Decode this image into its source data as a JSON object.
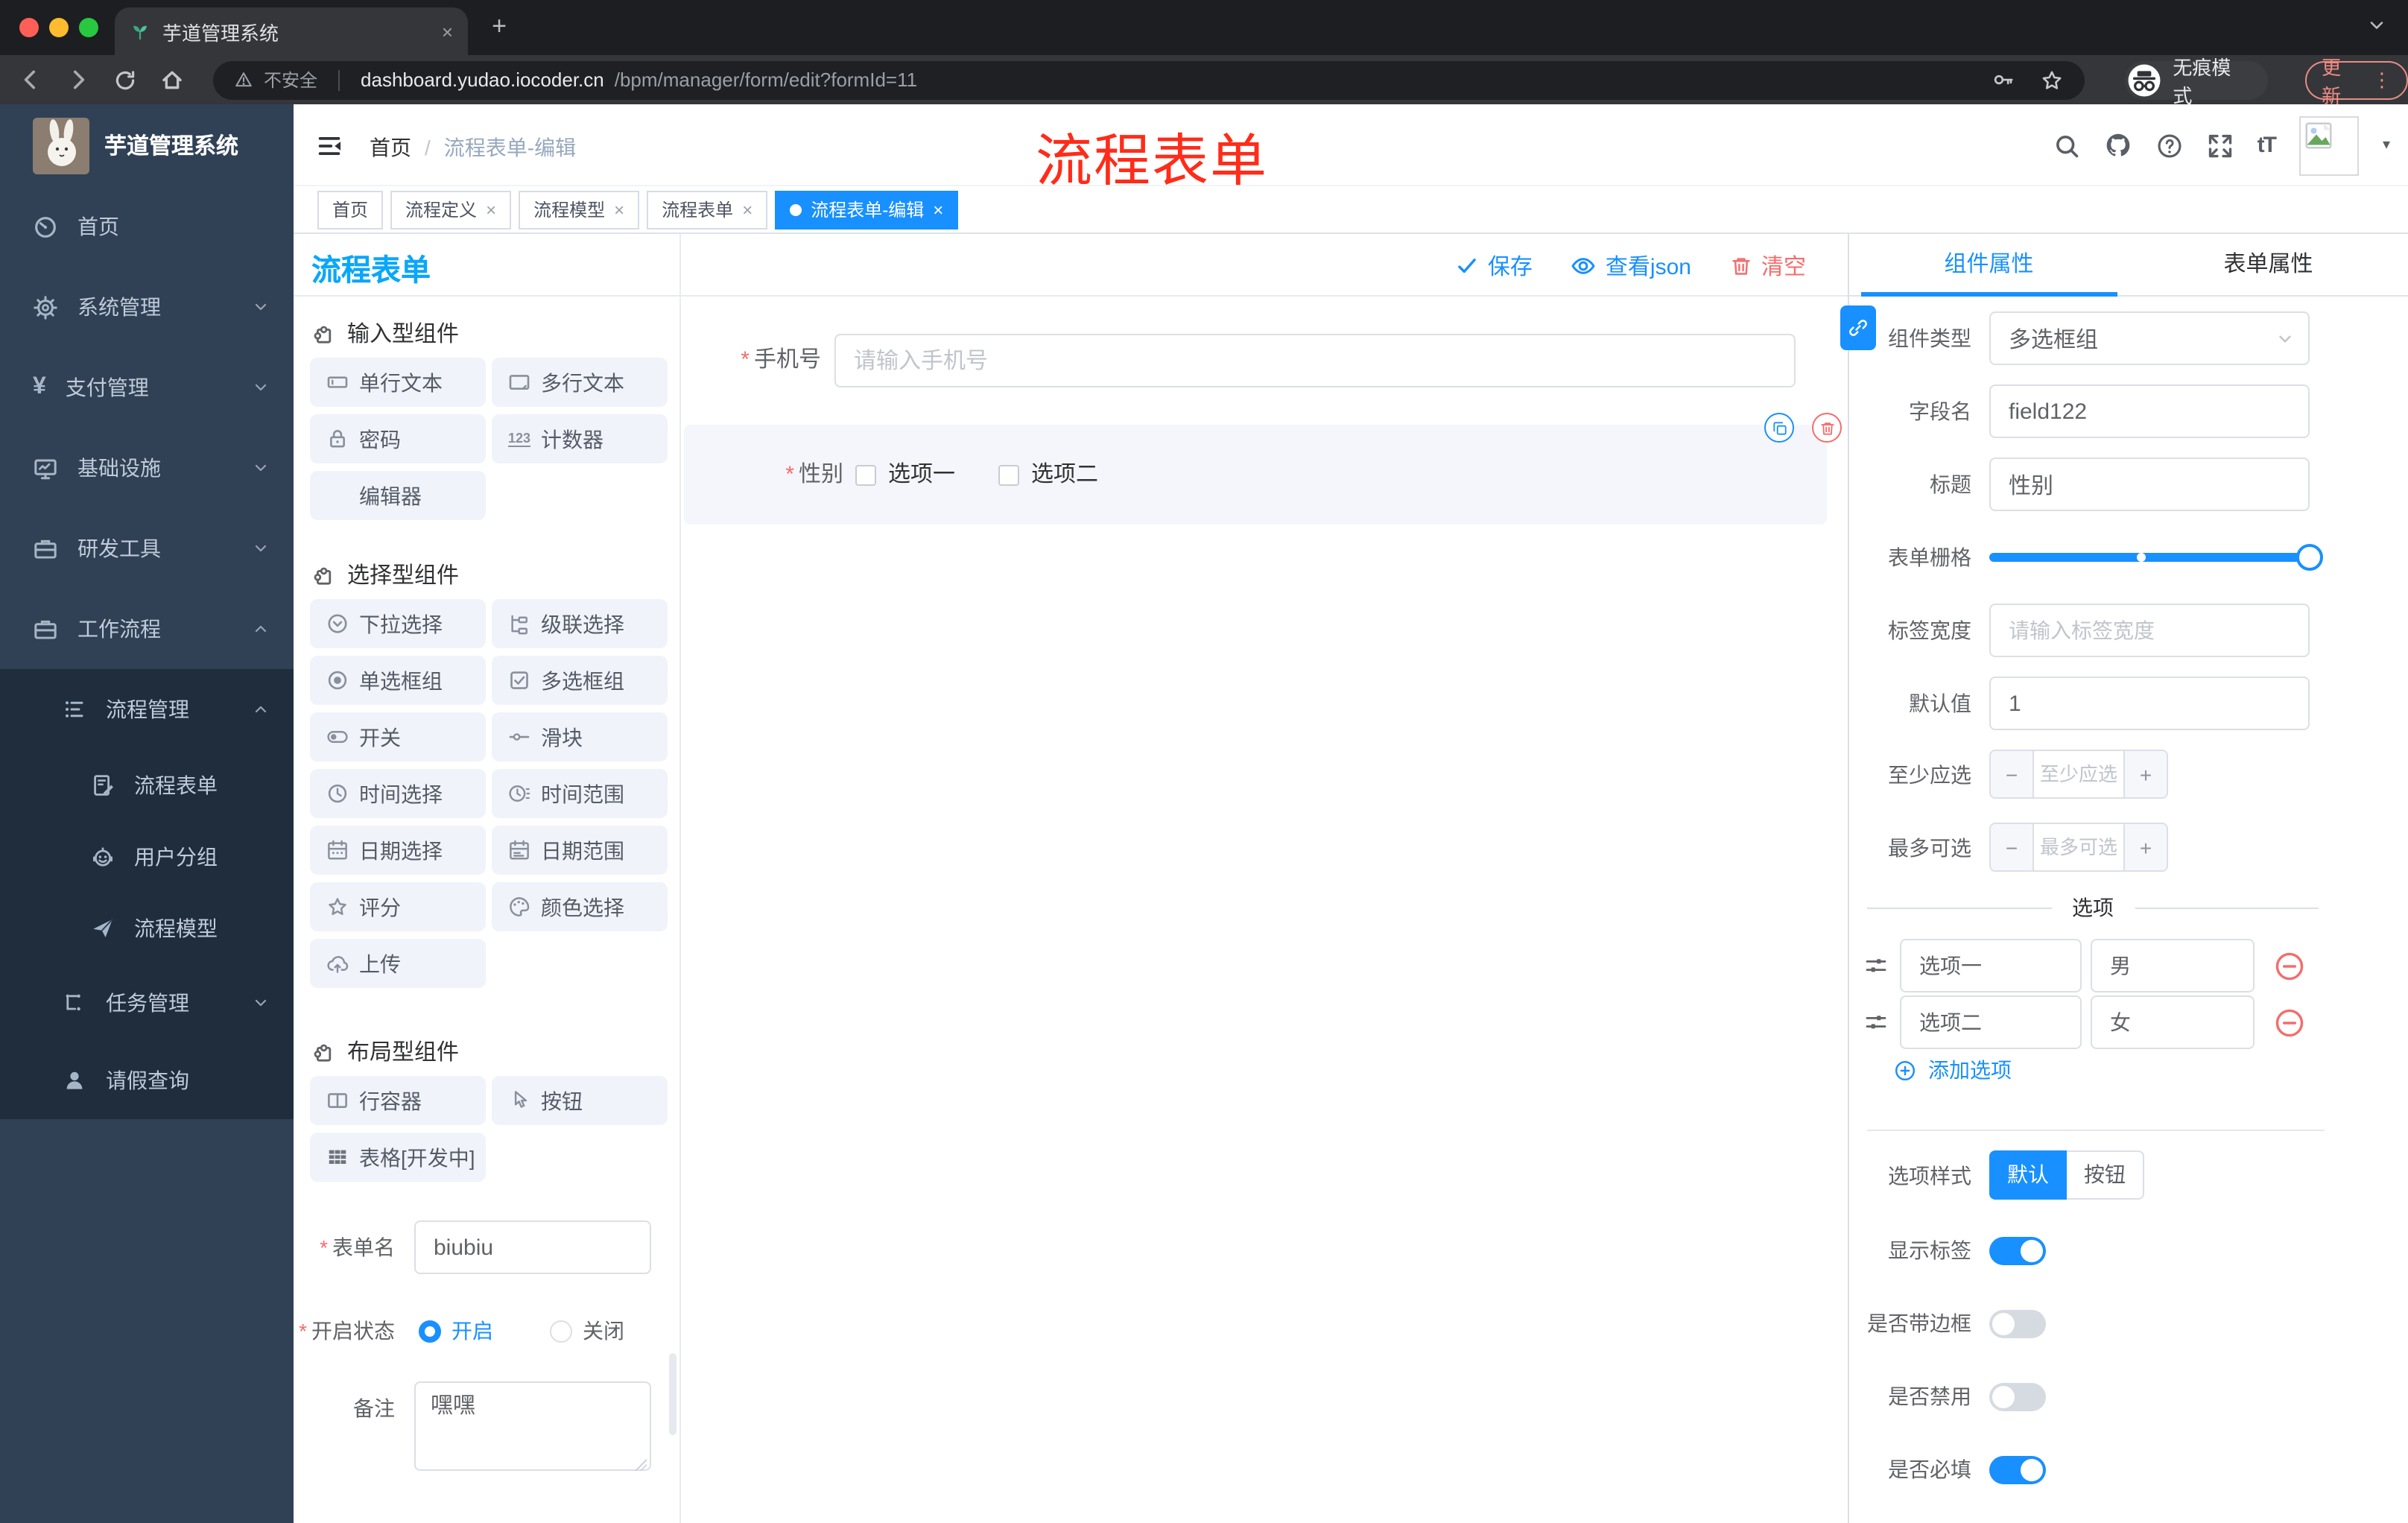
{
  "colors": {
    "theme": "#1890ff",
    "danger": "#f56c6c",
    "palette_title": "#0aa7f9",
    "annotation": "#fe2c19",
    "sidebar_bg": "#304156",
    "submenu_bg": "#1f2d3d"
  },
  "icons": {
    "close": "×",
    "plus": "+",
    "dots": "⋮",
    "caret": "▾",
    "asterisk": "*",
    "yen": "¥",
    "counter": "123",
    "font_size": "tT",
    "minus": "−",
    "slash": "/"
  },
  "browser": {
    "tab_title": "芋道管理系统",
    "security": "不安全",
    "url_host": "dashboard.yudao.iocoder.cn",
    "url_path": "/bpm/manager/form/edit?formId=11",
    "incognito": "无痕模式",
    "update": "更新"
  },
  "sidebar": {
    "logo_title": "芋道管理系统",
    "items": [
      {
        "label": "首页"
      },
      {
        "label": "系统管理"
      },
      {
        "label": "支付管理"
      },
      {
        "label": "基础设施"
      },
      {
        "label": "研发工具"
      },
      {
        "label": "工作流程"
      },
      {
        "label": "流程管理"
      },
      {
        "label": "流程表单"
      },
      {
        "label": "用户分组"
      },
      {
        "label": "流程模型"
      },
      {
        "label": "任务管理"
      },
      {
        "label": "请假查询"
      }
    ]
  },
  "header": {
    "breadcrumb_home": "首页",
    "breadcrumb_current": "流程表单-编辑",
    "annotation": "流程表单"
  },
  "tags": [
    {
      "label": "首页"
    },
    {
      "label": "流程定义"
    },
    {
      "label": "流程模型"
    },
    {
      "label": "流程表单"
    },
    {
      "label": "流程表单-编辑"
    }
  ],
  "palette": {
    "title": "流程表单",
    "sections": [
      {
        "title": "输入型组件",
        "items": [
          {
            "label": "单行文本"
          },
          {
            "label": "多行文本"
          },
          {
            "label": "密码"
          },
          {
            "label": "计数器"
          },
          {
            "label": "编辑器"
          }
        ]
      },
      {
        "title": "选择型组件",
        "items": [
          {
            "label": "下拉选择"
          },
          {
            "label": "级联选择"
          },
          {
            "label": "单选框组"
          },
          {
            "label": "多选框组"
          },
          {
            "label": "开关"
          },
          {
            "label": "滑块"
          },
          {
            "label": "时间选择"
          },
          {
            "label": "时间范围"
          },
          {
            "label": "日期选择"
          },
          {
            "label": "日期范围"
          },
          {
            "label": "评分"
          },
          {
            "label": "颜色选择"
          },
          {
            "label": "上传"
          }
        ]
      },
      {
        "title": "布局型组件",
        "items": [
          {
            "label": "行容器"
          },
          {
            "label": "按钮"
          },
          {
            "label": "表格[开发中]"
          }
        ]
      }
    ],
    "form": {
      "name_label": "表单名",
      "name_value": "biubiu",
      "status_label": "开启状态",
      "status_on": "开启",
      "status_off": "关闭",
      "remark_label": "备注",
      "remark_value": "嘿嘿"
    }
  },
  "canvas": {
    "save": "保存",
    "view_json": "查看json",
    "clear": "清空",
    "phone_label": "手机号",
    "phone_placeholder": "请输入手机号",
    "gender_label": "性别",
    "gender_options": [
      "选项一",
      "选项二"
    ]
  },
  "inspector": {
    "tab_component": "组件属性",
    "tab_form": "表单属性",
    "type_label": "组件类型",
    "type_value": "多选框组",
    "field_label": "字段名",
    "field_value": "field122",
    "title_label": "标题",
    "title_value": "性别",
    "grid_label": "表单栅格",
    "label_width_label": "标签宽度",
    "label_width_placeholder": "请输入标签宽度",
    "default_label": "默认值",
    "default_value": "1",
    "min_label": "至少应选",
    "min_placeholder": "至少应选",
    "max_label": "最多可选",
    "max_placeholder": "最多可选",
    "options_title": "选项",
    "options": [
      {
        "label": "选项一",
        "value": "男"
      },
      {
        "label": "选项二",
        "value": "女"
      }
    ],
    "add_option": "添加选项",
    "style_label": "选项样式",
    "style_default": "默认",
    "style_button": "按钮",
    "show_label": "显示标签",
    "border_label": "是否带边框",
    "disabled_label": "是否禁用",
    "required_label": "是否必填"
  }
}
